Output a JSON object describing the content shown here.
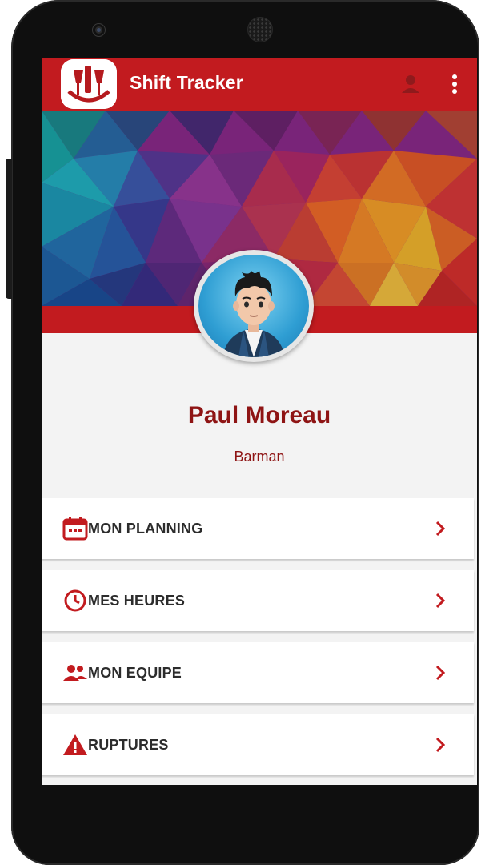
{
  "app": {
    "title": "Shift Tracker"
  },
  "profile": {
    "name": "Paul Moreau",
    "role": "Barman"
  },
  "menu": {
    "items": [
      {
        "label": "MON PLANNING",
        "icon": "calendar-icon"
      },
      {
        "label": "MES HEURES",
        "icon": "clock-icon"
      },
      {
        "label": "MON EQUIPE",
        "icon": "team-icon"
      },
      {
        "label": "RUPTURES",
        "icon": "warning-icon"
      }
    ]
  },
  "colors": {
    "brand_red": "#c21b1f",
    "text_dark_red": "#8e1414",
    "menu_text": "#2c2c2c"
  }
}
